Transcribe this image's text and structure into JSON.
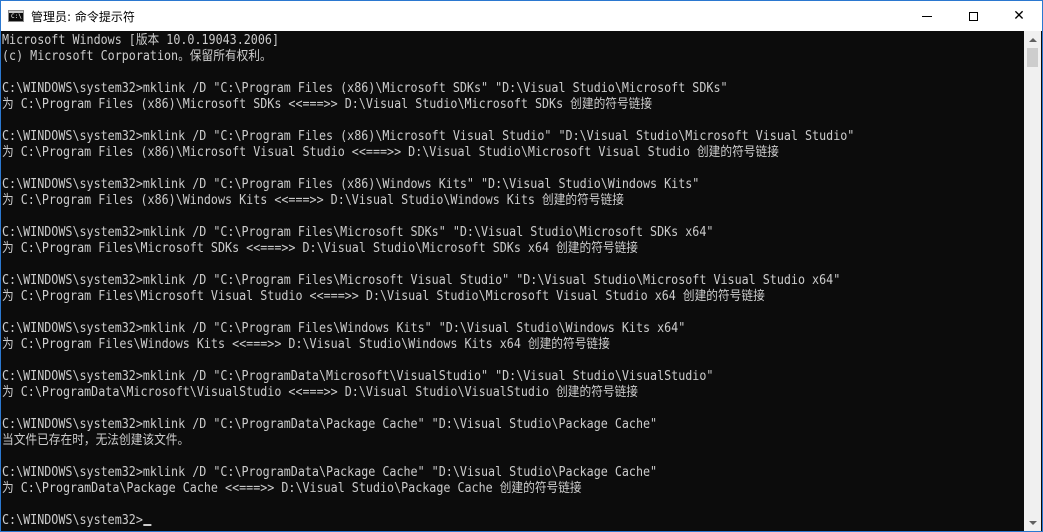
{
  "window": {
    "title": "管理员: 命令提示符",
    "app_icon_glyph": "C:\\",
    "minimize_glyph": "minimize-icon",
    "maximize_glyph": "maximize-icon",
    "close_symbol": "✕"
  },
  "console": {
    "background": "#0c0c0c",
    "foreground": "#cccccc",
    "lines": [
      "Microsoft Windows [版本 10.0.19043.2006]",
      "(c) Microsoft Corporation。保留所有权利。",
      "",
      "C:\\WINDOWS\\system32>mklink /D \"C:\\Program Files (x86)\\Microsoft SDKs\" \"D:\\Visual Studio\\Microsoft SDKs\"",
      "为 C:\\Program Files (x86)\\Microsoft SDKs <<===>> D:\\Visual Studio\\Microsoft SDKs 创建的符号链接",
      "",
      "C:\\WINDOWS\\system32>mklink /D \"C:\\Program Files (x86)\\Microsoft Visual Studio\" \"D:\\Visual Studio\\Microsoft Visual Studio\"",
      "为 C:\\Program Files (x86)\\Microsoft Visual Studio <<===>> D:\\Visual Studio\\Microsoft Visual Studio 创建的符号链接",
      "",
      "C:\\WINDOWS\\system32>mklink /D \"C:\\Program Files (x86)\\Windows Kits\" \"D:\\Visual Studio\\Windows Kits\"",
      "为 C:\\Program Files (x86)\\Windows Kits <<===>> D:\\Visual Studio\\Windows Kits 创建的符号链接",
      "",
      "C:\\WINDOWS\\system32>mklink /D \"C:\\Program Files\\Microsoft SDKs\" \"D:\\Visual Studio\\Microsoft SDKs x64\"",
      "为 C:\\Program Files\\Microsoft SDKs <<===>> D:\\Visual Studio\\Microsoft SDKs x64 创建的符号链接",
      "",
      "C:\\WINDOWS\\system32>mklink /D \"C:\\Program Files\\Microsoft Visual Studio\" \"D:\\Visual Studio\\Microsoft Visual Studio x64\"",
      "为 C:\\Program Files\\Microsoft Visual Studio <<===>> D:\\Visual Studio\\Microsoft Visual Studio x64 创建的符号链接",
      "",
      "C:\\WINDOWS\\system32>mklink /D \"C:\\Program Files\\Windows Kits\" \"D:\\Visual Studio\\Windows Kits x64\"",
      "为 C:\\Program Files\\Windows Kits <<===>> D:\\Visual Studio\\Windows Kits x64 创建的符号链接",
      "",
      "C:\\WINDOWS\\system32>mklink /D \"C:\\ProgramData\\Microsoft\\VisualStudio\" \"D:\\Visual Studio\\VisualStudio\"",
      "为 C:\\ProgramData\\Microsoft\\VisualStudio <<===>> D:\\Visual Studio\\VisualStudio 创建的符号链接",
      "",
      "C:\\WINDOWS\\system32>mklink /D \"C:\\ProgramData\\Package Cache\" \"D:\\Visual Studio\\Package Cache\"",
      "当文件已存在时，无法创建该文件。",
      "",
      "C:\\WINDOWS\\system32>mklink /D \"C:\\ProgramData\\Package Cache\" \"D:\\Visual Studio\\Package Cache\"",
      "为 C:\\ProgramData\\Package Cache <<===>> D:\\Visual Studio\\Package Cache 创建的符号链接",
      ""
    ],
    "prompt": "C:\\WINDOWS\\system32>"
  }
}
